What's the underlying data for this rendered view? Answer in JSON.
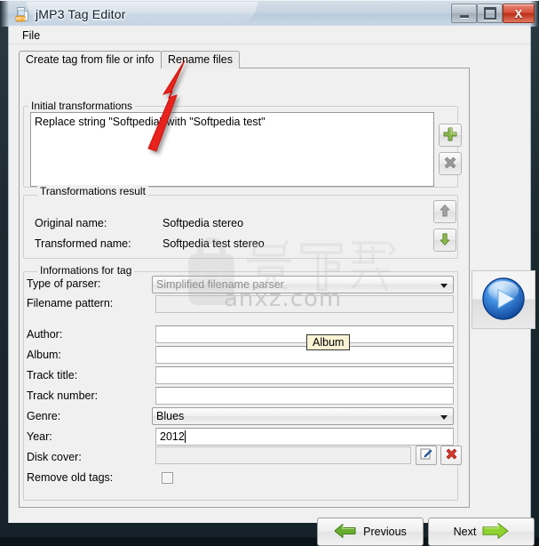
{
  "window": {
    "title": "jMP3 Tag Editor",
    "icon": "mp3-file-icon",
    "controls": {
      "minimize": "–",
      "maximize": "□",
      "close": "X"
    }
  },
  "menubar": {
    "items": [
      "File"
    ]
  },
  "tabs": [
    {
      "label": "Create tag from file or info",
      "selected": true
    },
    {
      "label": "Rename files",
      "selected": false
    }
  ],
  "groups": {
    "initial_transformations": {
      "title": "Initial transformations",
      "items": [
        "Replace string \"Softpedia\" with \"Softpedia test\""
      ],
      "buttons": [
        {
          "name": "add",
          "icon": "green-plus-icon"
        },
        {
          "name": "delete",
          "icon": "gray-x-icon"
        }
      ]
    },
    "transformations_result": {
      "title": "Transformations result",
      "rows": [
        {
          "label": "Original name:",
          "value": "Softpedia stereo"
        },
        {
          "label": "Transformed name:",
          "value": "Softpedia test stereo"
        }
      ],
      "buttons": [
        {
          "name": "move-up",
          "icon": "gray-up-arrow-icon"
        },
        {
          "name": "move-down",
          "icon": "green-down-arrow-icon"
        }
      ]
    },
    "informations_for_tag": {
      "title": "Informations for tag",
      "fields": [
        {
          "label": "Type of parser:",
          "type": "combo",
          "value": "Simplified filename parser",
          "disabled": true
        },
        {
          "label": "Filename pattern:",
          "type": "text",
          "value": "",
          "disabled": true
        },
        {
          "label": "Author:",
          "type": "text",
          "value": ""
        },
        {
          "label": "Album:",
          "type": "text",
          "value": ""
        },
        {
          "label": "Track title:",
          "type": "text",
          "value": ""
        },
        {
          "label": "Track number:",
          "type": "text",
          "value": ""
        },
        {
          "label": "Genre:",
          "type": "combo",
          "value": "Blues"
        },
        {
          "label": "Year:",
          "type": "text",
          "value": "2012"
        },
        {
          "label": "Disk cover:",
          "type": "readonly",
          "value": ""
        },
        {
          "label": "Remove old tags:",
          "type": "checkbox",
          "value": "",
          "checked": false
        }
      ],
      "cover_buttons": [
        {
          "name": "choose-cover",
          "icon": "pencil-edit-icon"
        },
        {
          "name": "clear-cover",
          "icon": "red-x-icon"
        }
      ]
    }
  },
  "play_button": {
    "name": "play-button",
    "icon": "blue-play-circle-icon"
  },
  "tooltip": {
    "text": "Album"
  },
  "nav": {
    "previous": "Previous",
    "next": "Next"
  },
  "watermark": {
    "text": "anxz.com",
    "glyphs": "安下载"
  },
  "colors": {
    "accent_green": "#7ab648",
    "close_red": "#d8503a",
    "play_blue": "#1f6fd0",
    "tooltip_bg": "#fbf3d4",
    "annotation_red": "#e60000"
  }
}
